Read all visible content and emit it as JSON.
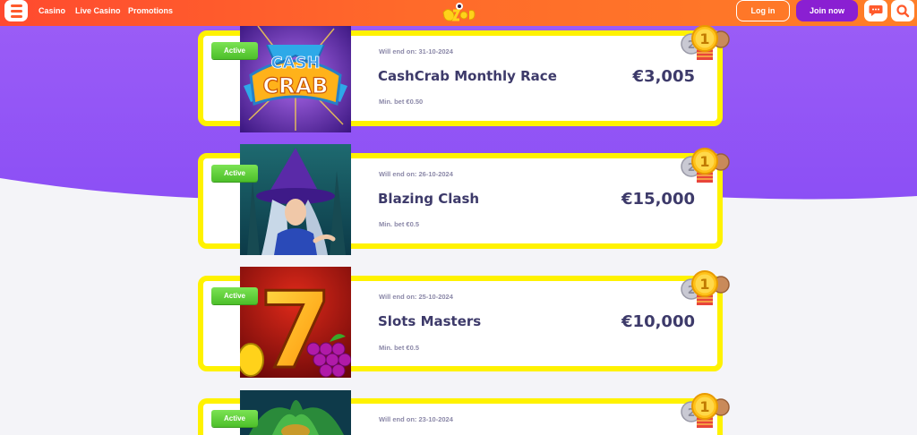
{
  "header": {
    "nav": [
      "Casino",
      "Live Casino",
      "Promotions"
    ],
    "login_label": "Log in",
    "join_label": "Join now",
    "icons": [
      "menu-icon",
      "chat-icon",
      "search-icon"
    ]
  },
  "colors": {
    "header": "#ff6a2a",
    "purple": "#8c4ff5",
    "card_border": "#fff200",
    "badge": "#5fd03b",
    "title": "#3d3a6a",
    "join_button": "#8a1fd2"
  },
  "tournaments": [
    {
      "status": "Active",
      "ends": "Will end on: 31-10-2024",
      "title": "CashCrab Monthly Race",
      "prize": "€3,005",
      "min_bet": "Min. bet €0.50",
      "medal_rank": "1",
      "image_text_1": "CASH",
      "image_text_2": "CRAB"
    },
    {
      "status": "Active",
      "ends": "Will end on: 26-10-2024",
      "title": "Blazing Clash",
      "prize": "€15,000",
      "min_bet": "Min. bet €0.5",
      "medal_rank": "1"
    },
    {
      "status": "Active",
      "ends": "Will end on: 25-10-2024",
      "title": "Slots Masters",
      "prize": "€10,000",
      "min_bet": "Min. bet €0.5",
      "medal_rank": "1",
      "image_text_1": "7"
    },
    {
      "status": "Active",
      "ends": "Will end on: 23-10-2024",
      "medal_rank": "1"
    }
  ]
}
